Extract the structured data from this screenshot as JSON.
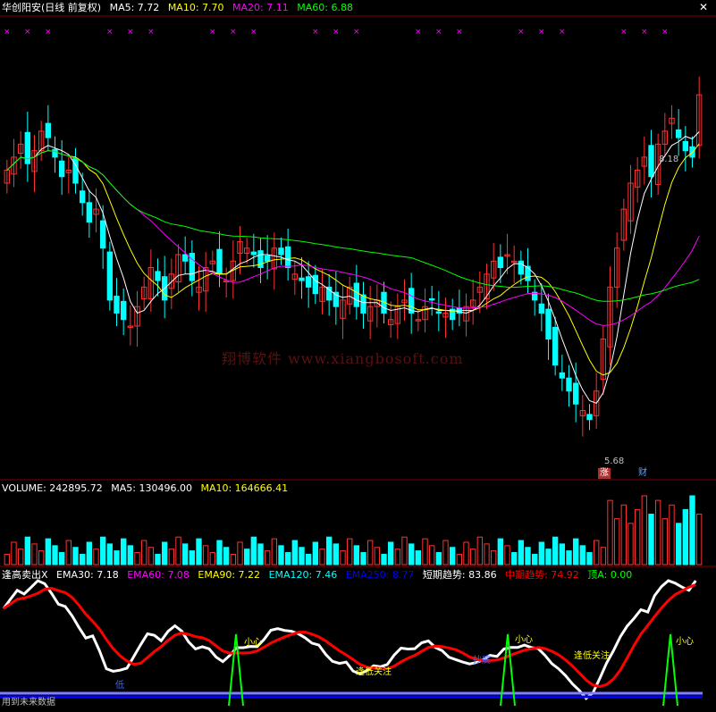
{
  "header": {
    "symbol": "华创阳安(日线 前复权)",
    "ma5": "MA5: 7.72",
    "ma10": "MA10: 7.70",
    "ma20": "MA20: 7.11",
    "ma60": "MA60: 6.88"
  },
  "volume_header": {
    "label": "VOLUME: 242895.72",
    "ma5": "MA5: 130496.00",
    "ma10": "MA10: 164666.41"
  },
  "indicator_header": {
    "name": "逢高卖出X",
    "ema30": "EMA30: 7.18",
    "ema60": "EMA60: 7.08",
    "ema90": "EMA90: 7.22",
    "ema120": "EMA120: 7.46",
    "ema250": "EMA250: 8.77",
    "short_trend": "短期趋势: 83.86",
    "mid_trend": "中期趋势: 74.92",
    "top": "顶A: 0.00"
  },
  "watermark": "翔博软件 www.xiangbosoft.com",
  "footer_note": "用到未来数据",
  "price_high_label": "8.18",
  "price_low_label": "5.68",
  "tags": {
    "zhang": "涨",
    "cai": "财"
  },
  "signals": {
    "xiaoxin": "小心",
    "feng_di": "逢低关注",
    "chao_di": "抄底",
    "di": "低"
  },
  "colors": {
    "up": "#ff3232",
    "down": "#00ffff",
    "ma5": "#ffffff",
    "ma10": "#ffff00",
    "ma20": "#ff00ff",
    "ma60": "#00ff00",
    "short": "#ffffff",
    "mid": "#ff0000",
    "ema250": "#0000ff",
    "grid": "#800000"
  },
  "chart_data": {
    "type": "candlestick",
    "price_range": [
      5.3,
      8.6
    ],
    "closes": [
      7.6,
      7.7,
      7.8,
      7.65,
      7.75,
      7.9,
      7.85,
      7.7,
      7.55,
      7.6,
      7.5,
      7.35,
      7.2,
      7.3,
      7.0,
      6.6,
      6.5,
      6.45,
      6.4,
      6.55,
      6.7,
      6.85,
      6.75,
      6.6,
      6.8,
      6.95,
      6.9,
      6.75,
      6.7,
      6.85,
      6.9,
      6.8,
      6.75,
      6.9,
      7.05,
      7.0,
      6.95,
      6.85,
      6.9,
      7.0,
      6.95,
      6.85,
      6.8,
      6.75,
      6.7,
      6.65,
      6.7,
      6.6,
      6.55,
      6.6,
      6.7,
      6.55,
      6.5,
      6.55,
      6.6,
      6.5,
      6.45,
      6.55,
      6.6,
      6.5,
      6.45,
      6.55,
      6.6,
      6.5,
      6.5,
      6.45,
      6.5,
      6.55,
      6.6,
      6.7,
      6.8,
      6.9,
      6.85,
      6.95,
      6.9,
      6.8,
      6.75,
      6.6,
      6.5,
      6.3,
      6.1,
      6.0,
      5.9,
      5.8,
      5.75,
      5.68,
      5.9,
      6.3,
      6.7,
      7.0,
      7.3,
      7.5,
      7.6,
      7.7,
      7.55,
      7.8,
      7.9,
      8.0,
      7.85,
      7.75,
      7.7,
      8.18
    ],
    "ma_values": {
      "MA5": 7.72,
      "MA10": 7.7,
      "MA20": 7.11,
      "MA60": 6.88
    },
    "volume": {
      "last": 242895.72,
      "ma5": 130496.0,
      "ma10": 164666.41
    },
    "indicator": {
      "EMA30": 7.18,
      "EMA60": 7.08,
      "EMA90": 7.22,
      "EMA120": 7.46,
      "EMA250": 8.77,
      "short_trend": 83.86,
      "mid_trend": 74.92,
      "top_A": 0.0
    }
  }
}
